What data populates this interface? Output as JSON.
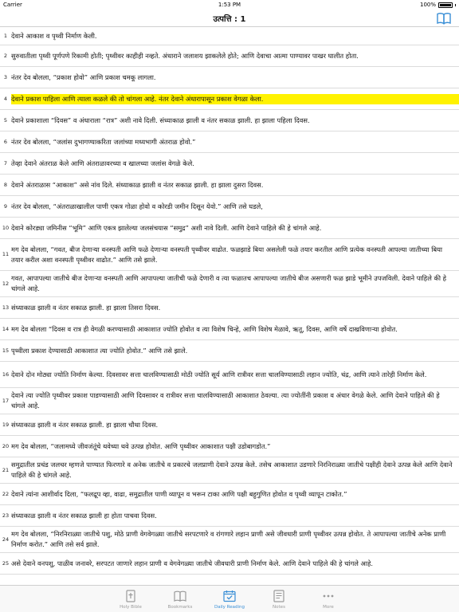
{
  "status_bar": {
    "carrier": "Carrier",
    "time": "1:53 PM",
    "battery": "100%"
  },
  "nav": {
    "title": "उत्पत्ति : 1"
  },
  "verses": [
    {
      "num": "1",
      "text": "देवाने आकाश व पृथ्वी निर्माण केली."
    },
    {
      "num": "2",
      "text": "सुरुवातीला पृथ्वी पूर्णपणे रिकामी होती; पृथ्वीवर काहीही नव्हते. अंधाराने जलाशय झाकलेले होते; आणि देवाचा आत्मा पाण्यावर पाखर घालीत होता."
    },
    {
      "num": "3",
      "text": "नंतर देव बोलला, “प्रकाश होवो” आणि प्रकाश चमकू लागला."
    },
    {
      "num": "4",
      "text": "देवाने प्रकाश पाहिला आणि त्याला कळले की तो चांगला आहे. नंतर देवाने अंधारापासून प्रकाश वेगळा केला."
    },
    {
      "num": "5",
      "text": "देवाने प्रकाशाला “दिवस” व अंधाराला “रात्र” अशी नावे दिली. संध्याकाळ झाली व नंतर सकाळ झाली. हा झाला पहिला दिवस."
    },
    {
      "num": "6",
      "text": "नंतर देव बोलला, “जलांस दुभागण्याकरिता जलांच्या मध्यभागी अंतराळ होवो.”"
    },
    {
      "num": "7",
      "text": "तेव्हा देवाने अंतराळ केले आणि अंतराळावरच्या व खालच्या जलांस वेगळे केले."
    },
    {
      "num": "8",
      "text": "देवाने अंतराळास “आकाश” असे नांव दिले. संध्याकाळ झाली व नंतर सकाळ झाली. हा झाला दुसरा दिवस."
    },
    {
      "num": "9",
      "text": "नंतर देव बोलला, “अंतराळाखालील पाणी एकत्र गोळा होवो व कोरडी जमीन दिसून येवो.” आणि तसे घडले,"
    },
    {
      "num": "10",
      "text": "देवाने कोरड्या जमिनीस “भूमि” आणि एकत्र झालेल्या जलसंचयास “समुद्र” अशी नावे दिली. आणि देवाने पाहिले की हे चांगले आहे."
    },
    {
      "num": "11",
      "text": "मग देव बोलला, “गवत, बीज देणाऱ्या वनस्पती आणि फळे देणाऱ्या वनस्पती पृथ्वीवर वाढोत. फळझाडे बिया असलेली फळे तयार करतील आणि प्रत्येक वनस्पती आपल्या जातीच्या बिया तयार करील अशा वनस्पती पृथ्वीवर वाढोत.” आणि तसे झाले."
    },
    {
      "num": "12",
      "text": "गवत, आपापल्या जातीचे बीज देणाऱ्या वनस्पती आणि आपापल्या जातीची फळे देणारी व त्या फळातच आपापल्या जातीचे बीज असणारी फळ झाडे भूमीने उपजविली. देवाने पाहिले की हे चांगले आहे."
    },
    {
      "num": "13",
      "text": "संध्याकाळ झाली व नंतर सकाळ झाली. हा झाला तिसरा दिवस."
    },
    {
      "num": "14",
      "text": "मग देव बोलला “दिवस व रात्र ही वेगळी करण्यासाठी आकाशात ज्योति होवोत व त्या विशेष चिन्हे, आणि विशेष मेळावे, ऋतू, दिवस, आणि वर्षे दाखविणाऱ्या होवोत."
    },
    {
      "num": "15",
      "text": "पृथ्वीला प्रकाश देण्यासाठी आकाशात त्या ज्योति होवोत.” आणि तसे झाले."
    },
    {
      "num": "16",
      "text": "देवाने दोन मोठ्या ज्योति निर्माण केल्या. दिवसावर सत्ता चालविण्यासाठी मोठी ज्योति सूर्य आणि रात्रीवर सत्ता चालविण्यासाठी लहान ज्योति, चंद्र, आणि त्याने तारेही निर्माण केले."
    },
    {
      "num": "17",
      "text": "देवाने त्या ज्योति पृथ्वीवर प्रकाश पाडण्यासाठी आणि दिवसावर व रात्रीवर सत्ता चालविण्यासाठी आकाशात ठेवल्या. त्या ज्योतींनी प्रकाश व अंधार वेगळे केले. आणि देवाने पाहिले की हे चांगले आहे."
    },
    {
      "num": "19",
      "text": "संध्याकाळ झाली व नंतर सकाळ झाली. हा झाला चौथा दिवस."
    },
    {
      "num": "20",
      "text": "मग देव बोलला, “जलामध्ये जीवजंतूंचे थवेच्या थवे उत्पन्न होवोत. आणि पृथ्वीवर आकाशात पक्षी उडोबागडोत.”"
    },
    {
      "num": "21",
      "text": "समुद्रातील प्रचंड जलचर म्हणजे पाण्यात फिरणारे व अनेक जातीचे व प्रकारचे जलप्राणी देवाने उत्पन्न केले. तसेच आकाशात उडणारे निरनिराळ्या जातीचे पक्षीही देवाने उत्पन्न केले आणि देवाने पाहिले की हे चांगले आहे."
    },
    {
      "num": "22",
      "text": "देवाने त्यांना आशीर्वाद दिला, “फलद्रूप व्हा, वाढा, समुद्रातील पाणी व्यापून व भरून टाका आणि पक्षी बहुगुणित होवोत व पृथ्वी व्यापून टाकोत.”"
    },
    {
      "num": "23",
      "text": "संध्याकाळ झाली व नंतर सकाळ झाली हा होता पाचवा दिवस."
    },
    {
      "num": "24",
      "text": "मग देव बोलला, “निरनिराळ्या जातीचे पशु, मोठे प्राणी वेगवेगळ्या जातीचे सरपटणारे व रांगणारे लहान प्राणी असे जीवधारी प्राणी पृथ्वीवर उत्पन्न होवोत. ते आपापल्या जातीचे अनेक प्राणी निर्माण करोत.” आणि तसे सर्व झाले."
    },
    {
      "num": "25",
      "text": "असे देवाने वनपशु, पाळीव जनावरे, सरपटत जाणारे लहान प्राणी व वेगवेगळ्या जातीचे जीवधारी प्राणी निर्माण केले. आणि देवाने पाहिले की हे चांगले आहे."
    }
  ],
  "tabs": [
    {
      "label": "Holy Bible",
      "icon": "bible-icon"
    },
    {
      "label": "Bookmarks",
      "icon": "bookmarks-icon"
    },
    {
      "label": "Daily Reading",
      "icon": "calendar-check-icon"
    },
    {
      "label": "Notes",
      "icon": "notes-icon"
    },
    {
      "label": "More",
      "icon": "more-icon"
    }
  ],
  "colors": {
    "highlight": "#fff200",
    "accent": "#3a8fd6",
    "inactive": "#9a9a9a"
  }
}
